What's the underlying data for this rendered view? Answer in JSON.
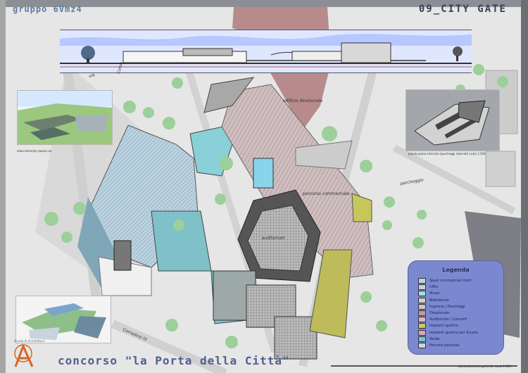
{
  "header": {
    "group_label": "gruppo 6Vmz4",
    "project_title": "09_CITY GATE"
  },
  "footer": {
    "competition_title": "concorso \"la Porta della Città\"",
    "logo_text": "Scuola di Architettura",
    "plan_caption": "planivolumetria generale  scala 1:500"
  },
  "captions": {
    "render_left": "allacciamento piazza via",
    "mini_plan": "pianta piano interrato (parcheggi interrati) scala 1:500",
    "street_left": "Corso",
    "street_bottom": "Corradino IV",
    "building_label_1": "edificio direzionale",
    "building_label_2": "parcheggio",
    "building_label_3": "auditorium",
    "building_label_4": "percorso commerciale",
    "building_label_5": "via"
  },
  "legend": {
    "title": "Legenda",
    "items": [
      {
        "label": "Spazi commerciali misti",
        "color": "#b7d9df"
      },
      {
        "label": "Uffici",
        "color": "#d0d0d0"
      },
      {
        "label": "Musei",
        "color": "#9fdede"
      },
      {
        "label": "Biblioteche",
        "color": "#cfcfcf"
      },
      {
        "label": "Ingresso / Parcheggi",
        "color": "#c8c8c8"
      },
      {
        "label": "Direzionale",
        "color": "#c99b9a"
      },
      {
        "label": "Auditorium / Concerti",
        "color": "#d8b9b8"
      },
      {
        "label": "Impianti sportivi",
        "color": "#c9c95c"
      },
      {
        "label": "Impianti sportivi per Scuola",
        "color": "#d9a4c6"
      },
      {
        "label": "Verde",
        "color": "#74c7c8"
      },
      {
        "label": "Percorsi pedonali",
        "color": "#d3d3d3"
      }
    ]
  },
  "colors": {
    "accent_blue": "#5f7ba6",
    "legend_bg": "#7a88cf",
    "building_red": "#b98b8d",
    "building_teal": "#7fc1c8",
    "building_olive": "#bdbb5a"
  }
}
